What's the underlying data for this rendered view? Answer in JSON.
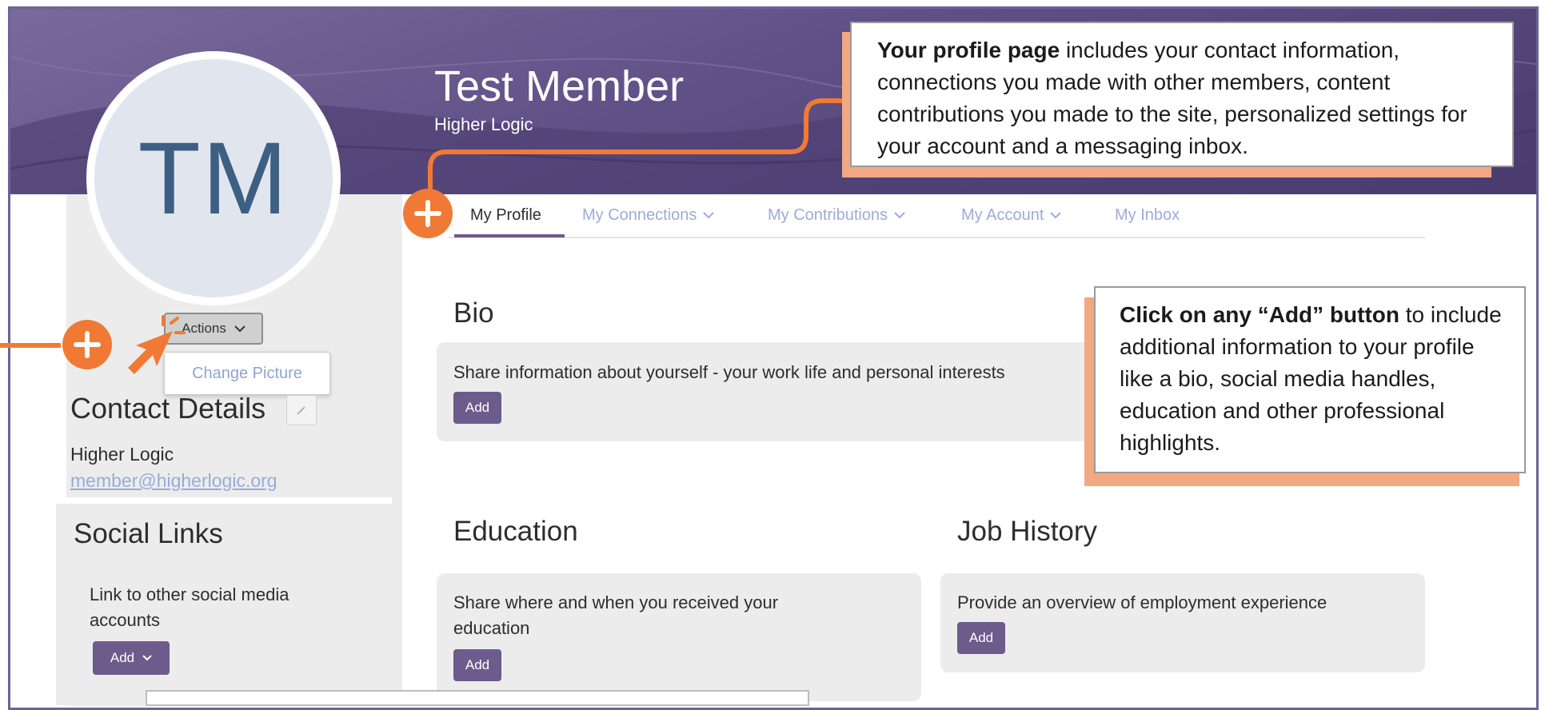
{
  "profile": {
    "initials": "TM",
    "name": "Test Member",
    "organization": "Higher Logic"
  },
  "tabs": [
    {
      "label": "My Profile",
      "active": true
    },
    {
      "label": "My Connections",
      "dropdown": true
    },
    {
      "label": "My Contributions",
      "dropdown": true
    },
    {
      "label": "My Account",
      "dropdown": true
    },
    {
      "label": "My Inbox"
    }
  ],
  "actions": {
    "button_label": "Actions",
    "menu_items": [
      "Change Picture"
    ]
  },
  "contact": {
    "title": "Contact Details",
    "organization": "Higher Logic",
    "email": "member@higherlogic.org"
  },
  "social": {
    "title": "Social Links",
    "description": "Link to other social media accounts",
    "add_label": "Add"
  },
  "bio": {
    "title": "Bio",
    "description": "Share information about yourself - your work life and personal interests",
    "add_label": "Add"
  },
  "education": {
    "title": "Education",
    "description": "Share where and when you received your education",
    "add_label": "Add"
  },
  "job_history": {
    "title": "Job History",
    "description": "Provide an overview of employment experience",
    "add_label": "Add"
  },
  "callouts": {
    "profile": {
      "bold": "Your profile page",
      "text": " includes your contact information, connections you made with other members, content contributions you made to the site, personalized settings for your account and a messaging inbox."
    },
    "add": {
      "bold": "Click on any “Add” button",
      "text": " to include additional information to your profile like a bio, social media handles, education and other professional highlights."
    }
  },
  "colors": {
    "accent": "#6c5b8b",
    "banner": "#5f5086",
    "annotation": "#f07a35",
    "link": "#98acd9"
  },
  "icons": [
    "plus-icon",
    "chevron-down-icon",
    "pencil-icon",
    "click-arrow-icon"
  ]
}
